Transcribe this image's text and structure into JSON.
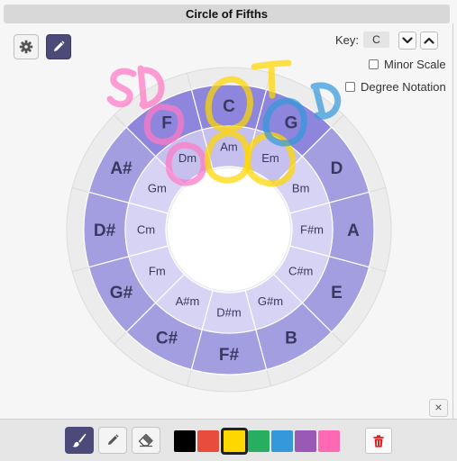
{
  "window": {
    "title": "Circle of Fifths"
  },
  "toolbar": {
    "settings_icon": "gear-icon",
    "draw_icon": "pencil-icon",
    "draw_active": true
  },
  "key_selector": {
    "label": "Key:",
    "value": "C",
    "down_icon": "chevron-down-icon",
    "up_icon": "chevron-up-icon"
  },
  "options": {
    "minor_scale": {
      "label": "Minor Scale",
      "checked": false
    },
    "degree_notation": {
      "label": "Degree Notation",
      "checked": false
    }
  },
  "wheel": {
    "major_keys": [
      "C",
      "G",
      "D",
      "A",
      "E",
      "B",
      "F#",
      "C#",
      "G#",
      "D#",
      "A#",
      "F"
    ],
    "minor_keys": [
      "Am",
      "Em",
      "Bm",
      "F#m",
      "C#m",
      "G#m",
      "D#m",
      "A#m",
      "Fm",
      "Cm",
      "Gm",
      "Dm"
    ],
    "colors": {
      "major": "#a29ee0",
      "major_active": "#8d86dc",
      "minor": "#d6d3f4",
      "minor_active": "#c5c0ee",
      "outer_ring": "#ececec"
    }
  },
  "annotations": [
    {
      "text": "SD",
      "color": "#ff79c6"
    },
    {
      "text": "T",
      "color": "#ffd700"
    },
    {
      "text": "D",
      "color": "#3498db"
    }
  ],
  "close_label": "×",
  "drawing_tools": {
    "brush_icon": "brush-icon",
    "pencil_icon": "pencil-icon",
    "eraser_icon": "eraser-icon",
    "selected_tool": "brush",
    "colors": [
      "#000000",
      "#e74c3c",
      "#ffd700",
      "#27ae60",
      "#3498db",
      "#9b59b6",
      "#ff69b4"
    ],
    "selected_color": "#ffd700",
    "trash_icon": "trash-icon"
  }
}
